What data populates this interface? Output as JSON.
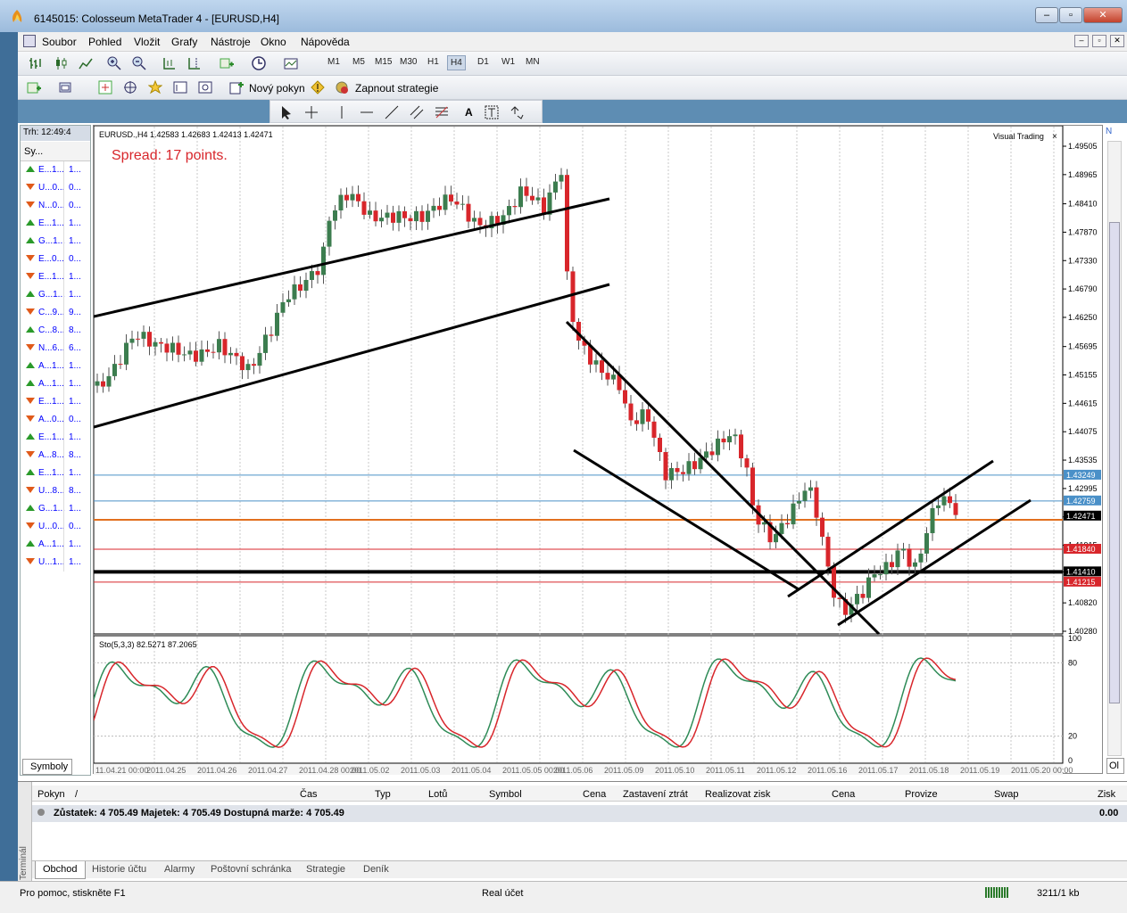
{
  "window": {
    "title": "6145015: Colosseum MetaTrader 4 - [EURUSD,H4]"
  },
  "menu": [
    "Soubor",
    "Pohled",
    "Vložit",
    "Grafy",
    "Nástroje",
    "Okno",
    "Nápověda"
  ],
  "timeframes": [
    "M1",
    "M5",
    "M15",
    "M30",
    "H1",
    "H4",
    "D1",
    "W1",
    "MN"
  ],
  "selected_timeframe": "H4",
  "toolbar2": {
    "new_order": "Nový pokyn",
    "strategy": "Zapnout strategie"
  },
  "market_watch": {
    "time": "Trh: 12:49:4",
    "col_symbol": "Sy...",
    "rows": [
      {
        "s": "E...",
        "a": "1...",
        "b": "1...",
        "dir": "up"
      },
      {
        "s": "U...",
        "a": "0...",
        "b": "0...",
        "dir": "down"
      },
      {
        "s": "N...",
        "a": "0...",
        "b": "0...",
        "dir": "down"
      },
      {
        "s": "E...",
        "a": "1...",
        "b": "1...",
        "dir": "up"
      },
      {
        "s": "G...",
        "a": "1...",
        "b": "1...",
        "dir": "up"
      },
      {
        "s": "E...",
        "a": "0...",
        "b": "0...",
        "dir": "down"
      },
      {
        "s": "E...",
        "a": "1...",
        "b": "1...",
        "dir": "down"
      },
      {
        "s": "G...",
        "a": "1...",
        "b": "1...",
        "dir": "up"
      },
      {
        "s": "C...",
        "a": "9...",
        "b": "9...",
        "dir": "down"
      },
      {
        "s": "C...",
        "a": "8...",
        "b": "8...",
        "dir": "up"
      },
      {
        "s": "N...",
        "a": "6...",
        "b": "6...",
        "dir": "down"
      },
      {
        "s": "A...",
        "a": "1...",
        "b": "1...",
        "dir": "up"
      },
      {
        "s": "A...",
        "a": "1...",
        "b": "1...",
        "dir": "up"
      },
      {
        "s": "E...",
        "a": "1...",
        "b": "1...",
        "dir": "down"
      },
      {
        "s": "A...",
        "a": "0...",
        "b": "0...",
        "dir": "down"
      },
      {
        "s": "E...",
        "a": "1...",
        "b": "1...",
        "dir": "up"
      },
      {
        "s": "A...",
        "a": "8...",
        "b": "8...",
        "dir": "down"
      },
      {
        "s": "E...",
        "a": "1...",
        "b": "1...",
        "dir": "up"
      },
      {
        "s": "U...",
        "a": "8...",
        "b": "8...",
        "dir": "down"
      },
      {
        "s": "G...",
        "a": "1...",
        "b": "1...",
        "dir": "up"
      },
      {
        "s": "U...",
        "a": "0...",
        "b": "0...",
        "dir": "down"
      },
      {
        "s": "A...",
        "a": "1...",
        "b": "1...",
        "dir": "up"
      },
      {
        "s": "U...",
        "a": "1...",
        "b": "1...",
        "dir": "down"
      }
    ],
    "tab": "Symboly"
  },
  "chart": {
    "header": "EURUSD.,H4  1.42583 1.42683 1.42413 1.42471",
    "spread": "Spread: 17 points.",
    "visual_trading": "Visual Trading",
    "price_scale": [
      "1.49505",
      "1.48965",
      "1.48410",
      "1.47870",
      "1.47330",
      "1.46790",
      "1.46250",
      "1.45695",
      "1.45155",
      "1.44615",
      "1.44075",
      "1.43535",
      "1.42995",
      "1.42455",
      "1.41915",
      "1.41410",
      "1.40820",
      "1.40280"
    ],
    "current_price": "1.42471",
    "level_labels": [
      "1.43249",
      "1.42759",
      "1.41840",
      "1.41410",
      "1.41215"
    ],
    "stoch_label": "Sto(5,3,3) 82.5271 87.2065",
    "stoch_scale": [
      "100",
      "80",
      "20",
      "0"
    ],
    "time_axis": [
      "11.04.21 00:00",
      "2011.04.25",
      "2011.04.26",
      "2011.04.27",
      "2011.04.28 00:00",
      "2011.05.02",
      "2011.05.03",
      "2011.05.04",
      "2011.05.05 00:00",
      "2011.05.06",
      "2011.05.09",
      "2011.05.10",
      "2011.05.11",
      "2011.05.12",
      "2011.05.16",
      "2011.05.17",
      "2011.05.18",
      "2011.05.19",
      "2011.05.20 00:00"
    ],
    "colors": {
      "bull": "#3c7d4f",
      "bear": "#d8262b",
      "stoch_main": "#2e8b57",
      "stoch_signal": "#d8262b"
    }
  },
  "terminal": {
    "side_label": "Terminál",
    "columns": [
      "Pokyn",
      "/",
      "Čas",
      "Typ",
      "Lotů",
      "Symbol",
      "Cena",
      "Zastavení ztrát",
      "Realizovat zisk",
      "Cena",
      "Provize",
      "Swap",
      "Zisk"
    ],
    "balance_row": "Zůstatek: 4 705.49  Majetek: 4 705.49  Dostupná marže: 4 705.49",
    "balance_profit": "0.00",
    "tabs": [
      "Obchod",
      "Historie účtu",
      "Alarmy",
      "Poštovní schránka",
      "Strategie",
      "Deník"
    ]
  },
  "status": {
    "help": "Pro pomoc, stiskněte F1",
    "profile": "Real účet",
    "traffic": "3211/1 kb"
  }
}
